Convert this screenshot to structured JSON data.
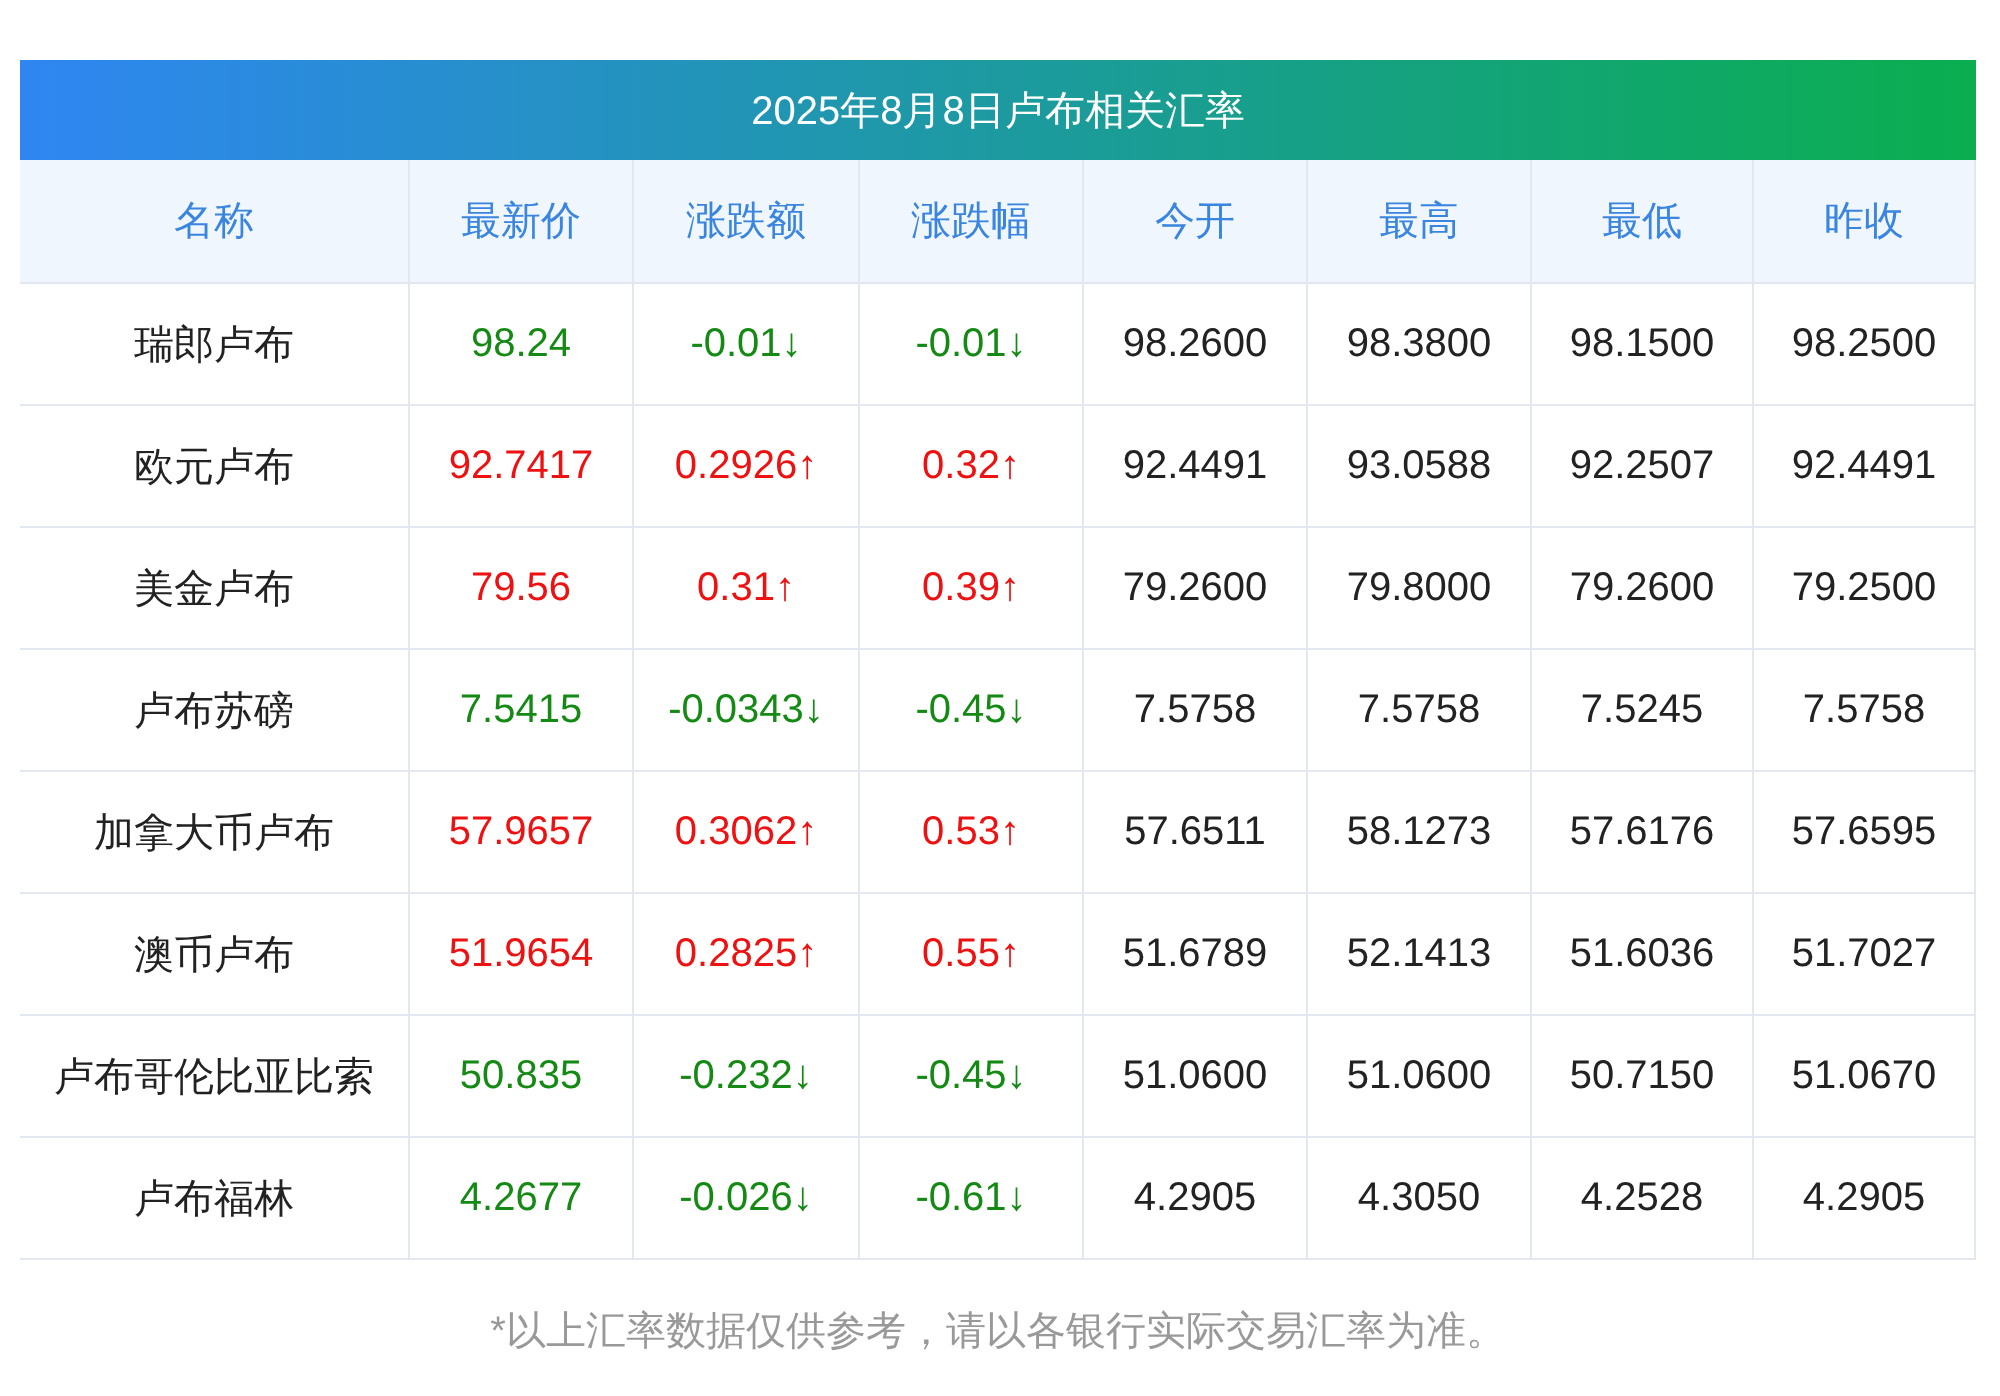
{
  "title": "2025年8月8日卢布相关汇率",
  "columns": [
    "名称",
    "最新价",
    "涨跌额",
    "涨跌幅",
    "今开",
    "最高",
    "最低",
    "昨收"
  ],
  "rows": [
    {
      "kind": "down",
      "cells": [
        "瑞郎卢布",
        "98.24",
        "-0.01↓",
        "-0.01↓",
        "98.2600",
        "98.3800",
        "98.1500",
        "98.2500"
      ]
    },
    {
      "kind": "up",
      "cells": [
        "欧元卢布",
        "92.7417",
        "0.2926↑",
        "0.32↑",
        "92.4491",
        "93.0588",
        "92.2507",
        "92.4491"
      ]
    },
    {
      "kind": "up",
      "cells": [
        "美金卢布",
        "79.56",
        "0.31↑",
        "0.39↑",
        "79.2600",
        "79.8000",
        "79.2600",
        "79.2500"
      ]
    },
    {
      "kind": "down",
      "cells": [
        "卢布苏磅",
        "7.5415",
        "-0.0343↓",
        "-0.45↓",
        "7.5758",
        "7.5758",
        "7.5245",
        "7.5758"
      ]
    },
    {
      "kind": "up",
      "cells": [
        "加拿大币卢布",
        "57.9657",
        "0.3062↑",
        "0.53↑",
        "57.6511",
        "58.1273",
        "57.6176",
        "57.6595"
      ]
    },
    {
      "kind": "up",
      "cells": [
        "澳币卢布",
        "51.9654",
        "0.2825↑",
        "0.55↑",
        "51.6789",
        "52.1413",
        "51.6036",
        "51.7027"
      ]
    },
    {
      "kind": "down",
      "cells": [
        "卢布哥伦比亚比索",
        "50.835",
        "-0.232↓",
        "-0.45↓",
        "51.0600",
        "51.0600",
        "50.7150",
        "51.0670"
      ]
    },
    {
      "kind": "down",
      "cells": [
        "卢布福林",
        "4.2677",
        "-0.026↓",
        "-0.61↓",
        "4.2905",
        "4.3050",
        "4.2528",
        "4.2905"
      ]
    }
  ],
  "footnote": "*以上汇率数据仅供参考，请以各银行实际交易汇率为准。"
}
